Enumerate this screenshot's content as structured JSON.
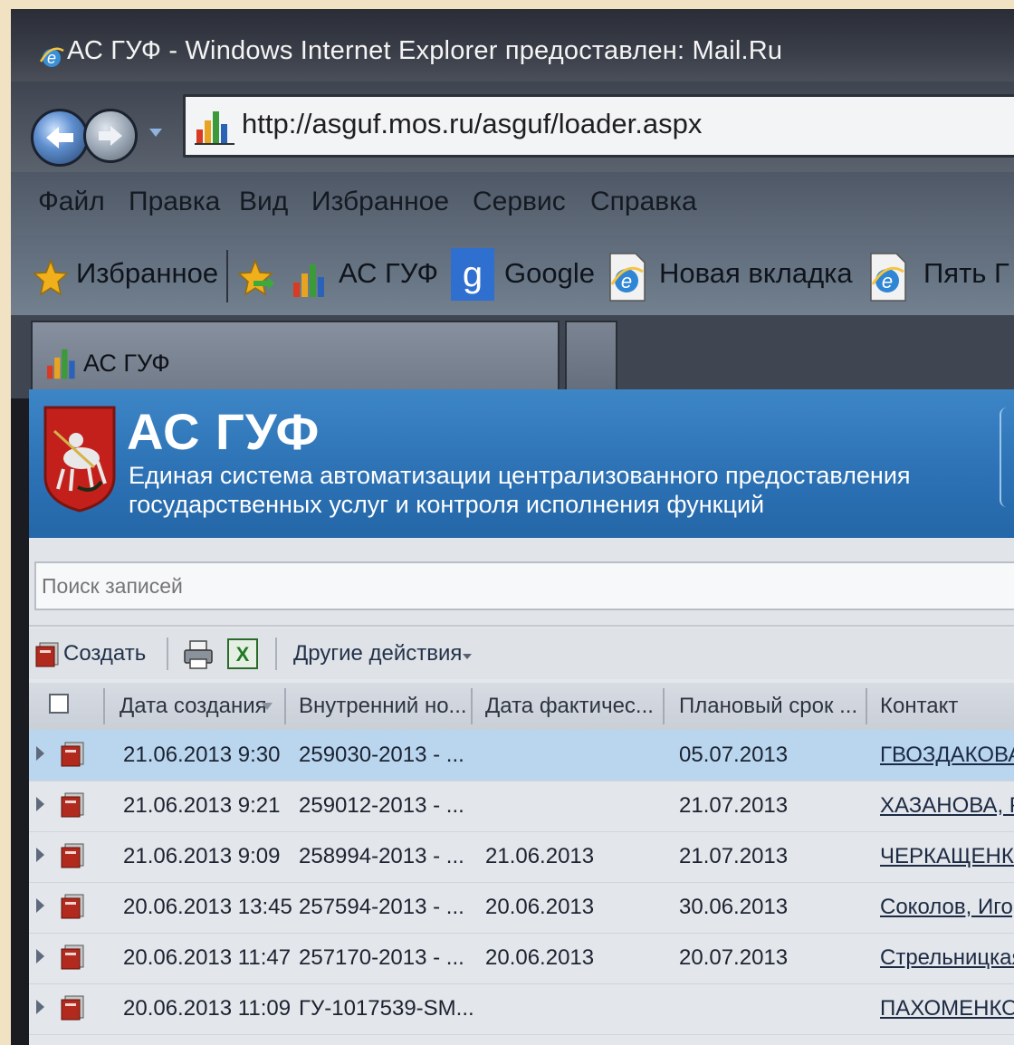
{
  "window": {
    "title": "АС ГУФ - Windows Internet Explorer предоставлен: Mail.Ru"
  },
  "address_bar": {
    "url": "http://asguf.mos.ru/asguf/loader.aspx"
  },
  "menu": {
    "items": [
      "Файл",
      "Правка",
      "Вид",
      "Избранное",
      "Сервис",
      "Справка"
    ]
  },
  "favorites_bar": {
    "favorites_label": "Избранное",
    "links": [
      "АС ГУФ",
      "Google",
      "Новая вкладка",
      "Пять Г"
    ]
  },
  "tabs": {
    "active_label": "АС ГУФ"
  },
  "app_header": {
    "title": "АС ГУФ",
    "subtitle_line1": "Единая система автоматизации централизованного предоставления",
    "subtitle_line2": "государственных услуг и контроля исполнения функций"
  },
  "search": {
    "placeholder": "Поиск записей"
  },
  "toolbar": {
    "create_label": "Создать",
    "other_actions_label": "Другие действия"
  },
  "grid": {
    "columns": [
      "Дата создания",
      "Внутренний но...",
      "Дата фактичес...",
      "Плановый срок ...",
      "Контакт"
    ],
    "rows": [
      {
        "created": "21.06.2013 9:30",
        "internal_no": "259030-2013 - ...",
        "actual_date": "",
        "planned": "05.07.2013",
        "contact": "ГВОЗДАКОВА"
      },
      {
        "created": "21.06.2013 9:21",
        "internal_no": "259012-2013 - ...",
        "actual_date": "",
        "planned": "21.07.2013",
        "contact": "ХАЗАНОВА, Р"
      },
      {
        "created": "21.06.2013 9:09",
        "internal_no": "258994-2013 - ...",
        "actual_date": "21.06.2013",
        "planned": "21.07.2013",
        "contact": "ЧЕРКАЩЕНКО"
      },
      {
        "created": "20.06.2013 13:45",
        "internal_no": "257594-2013 - ...",
        "actual_date": "20.06.2013",
        "planned": "30.06.2013",
        "contact": "Соколов, Игор"
      },
      {
        "created": "20.06.2013 11:47",
        "internal_no": "257170-2013 - ...",
        "actual_date": "20.06.2013",
        "planned": "20.07.2013",
        "contact": "Стрельницкая"
      },
      {
        "created": "20.06.2013 11:09",
        "internal_no": "ГУ-1017539-SM...",
        "actual_date": "",
        "planned": "",
        "contact": "ПАХОМЕНКО"
      }
    ]
  },
  "colors": {
    "header_blue": "#2c72b5",
    "selected_row": "#b9d6ee",
    "frame": "#f2e2c4"
  }
}
